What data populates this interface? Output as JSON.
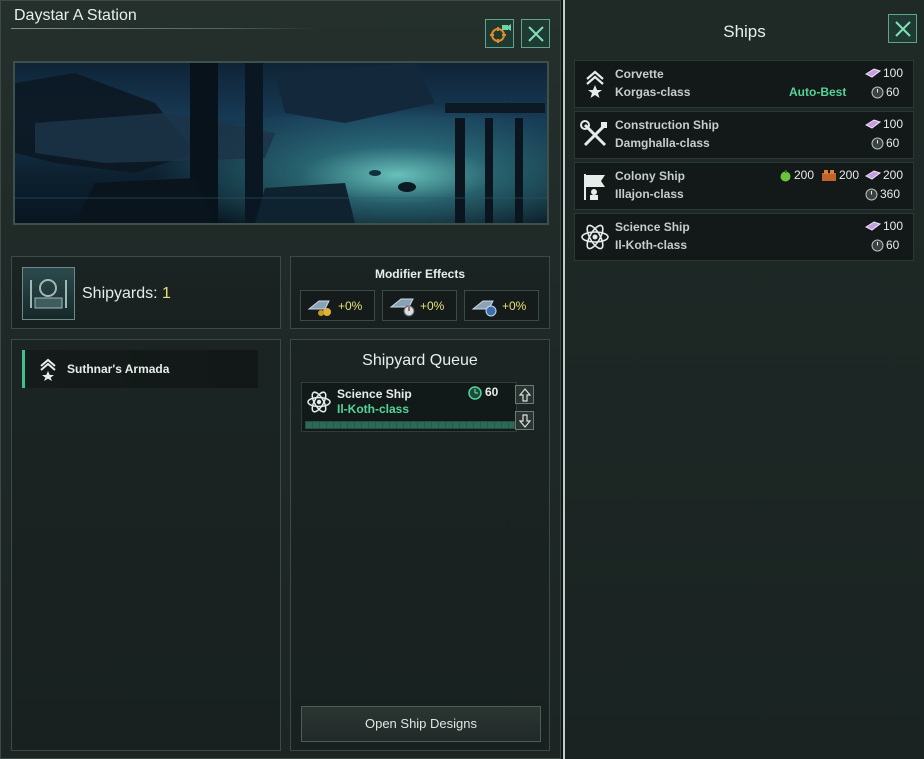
{
  "station": {
    "title": "Daystar A Station",
    "locate_icon": "camera-target-icon",
    "close_icon": "close-icon"
  },
  "shipyards": {
    "label": "Shipyards:",
    "count": "1"
  },
  "modifiers": {
    "title": "Modifier Effects",
    "items": [
      {
        "icon": "build-cost-icon",
        "value": "+0%"
      },
      {
        "icon": "build-speed-icon",
        "value": "+0%"
      },
      {
        "icon": "build-time-icon",
        "value": "+0%"
      }
    ]
  },
  "fleets": {
    "items": [
      {
        "name": "Suthnar's Armada",
        "icon": "fleet-rank-icon"
      }
    ]
  },
  "queue": {
    "title": "Shipyard Queue",
    "items": [
      {
        "name": "Science Ship",
        "class": "Il-Koth-class",
        "time": "60",
        "icon": "atom-icon"
      }
    ],
    "open_designs_label": "Open Ship Designs"
  },
  "ships": {
    "title": "Ships",
    "items": [
      {
        "name": "Corvette",
        "class": "Korgas-class",
        "tag": "Auto-Best",
        "alloys": "100",
        "time": "60",
        "icon": "corvette-rank-icon"
      },
      {
        "name": "Construction Ship",
        "class": "Damghalla-class",
        "alloys": "100",
        "time": "60",
        "icon": "wrench-tools-icon"
      },
      {
        "name": "Colony Ship",
        "class": "Illajon-class",
        "food": "200",
        "consumer_goods": "200",
        "alloys": "200",
        "time": "360",
        "icon": "colony-flag-icon"
      },
      {
        "name": "Science Ship",
        "class": "Il-Koth-class",
        "alloys": "100",
        "time": "60",
        "icon": "atom-icon"
      }
    ]
  },
  "colors": {
    "accent_green": "#55d49a",
    "count_yellow": "#e8e17a",
    "button_border": "#5fa58a"
  }
}
